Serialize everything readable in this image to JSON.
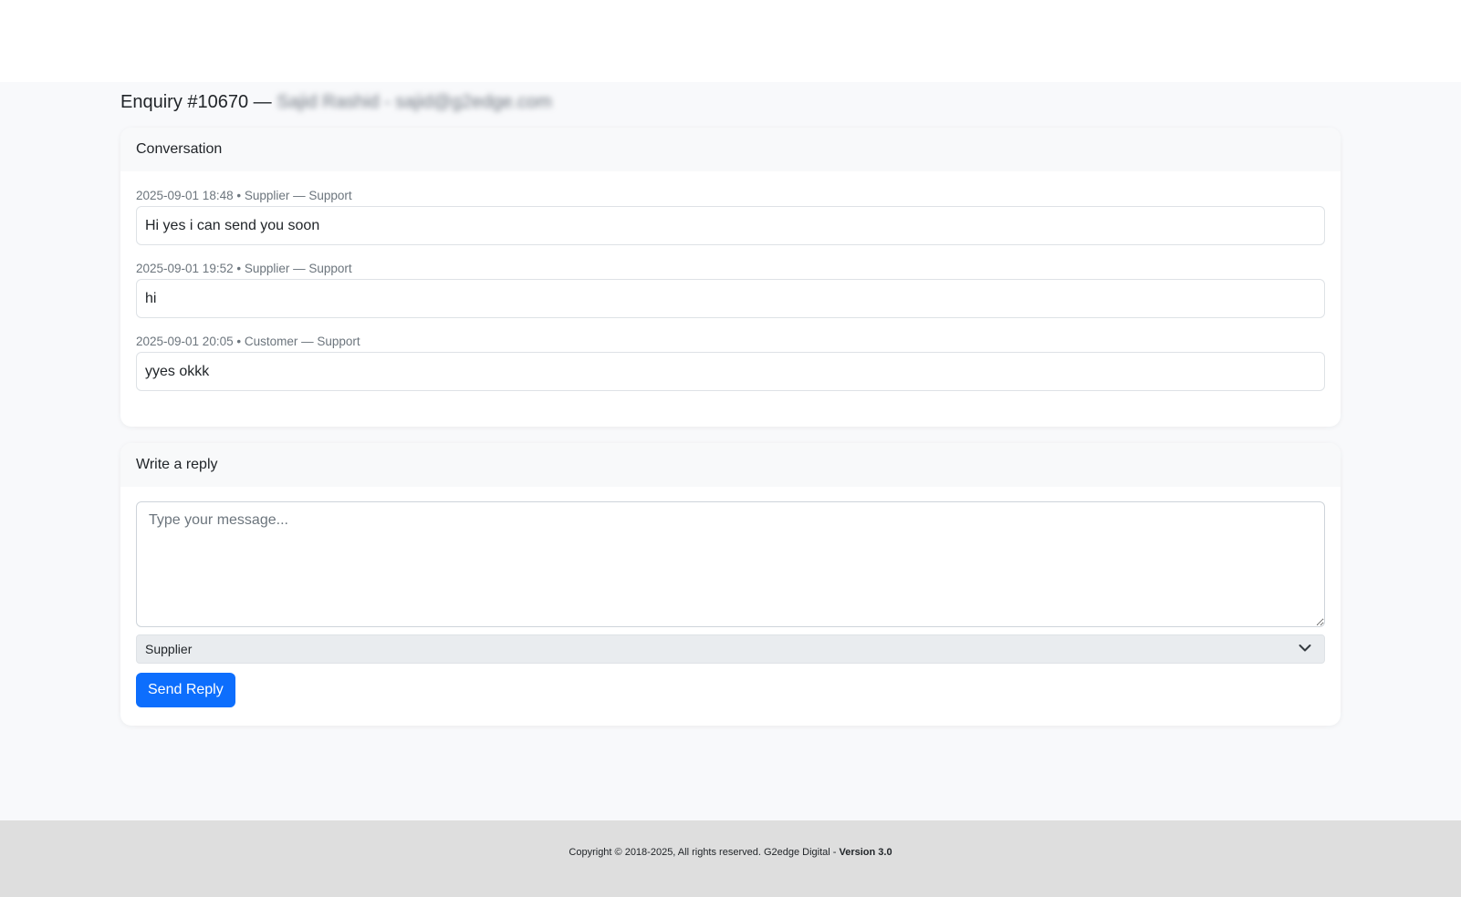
{
  "page": {
    "title_prefix": "Enquiry #10670 — ",
    "title_redacted": "Sajid Rashid - sajid@g2edge.com"
  },
  "conversation": {
    "header": "Conversation",
    "messages": [
      {
        "meta": "2025-09-01 18:48 • Supplier — Support",
        "body": "Hi yes i can send you soon"
      },
      {
        "meta": "2025-09-01 19:52 • Supplier — Support",
        "body": "hi"
      },
      {
        "meta": "2025-09-01 20:05 • Customer — Support",
        "body": "yyes okkk"
      }
    ]
  },
  "reply": {
    "header": "Write a reply",
    "placeholder": "Type your message...",
    "sender_selected": "Supplier",
    "send_label": "Send Reply"
  },
  "footer": {
    "copyright": "Copyright © 2018-2025, All rights reserved. G2edge Digital - ",
    "version": "Version 3.0"
  },
  "colors": {
    "primary": "#0d6efd",
    "page_bg": "#f8f9fb",
    "footer_bg": "#dedede"
  }
}
